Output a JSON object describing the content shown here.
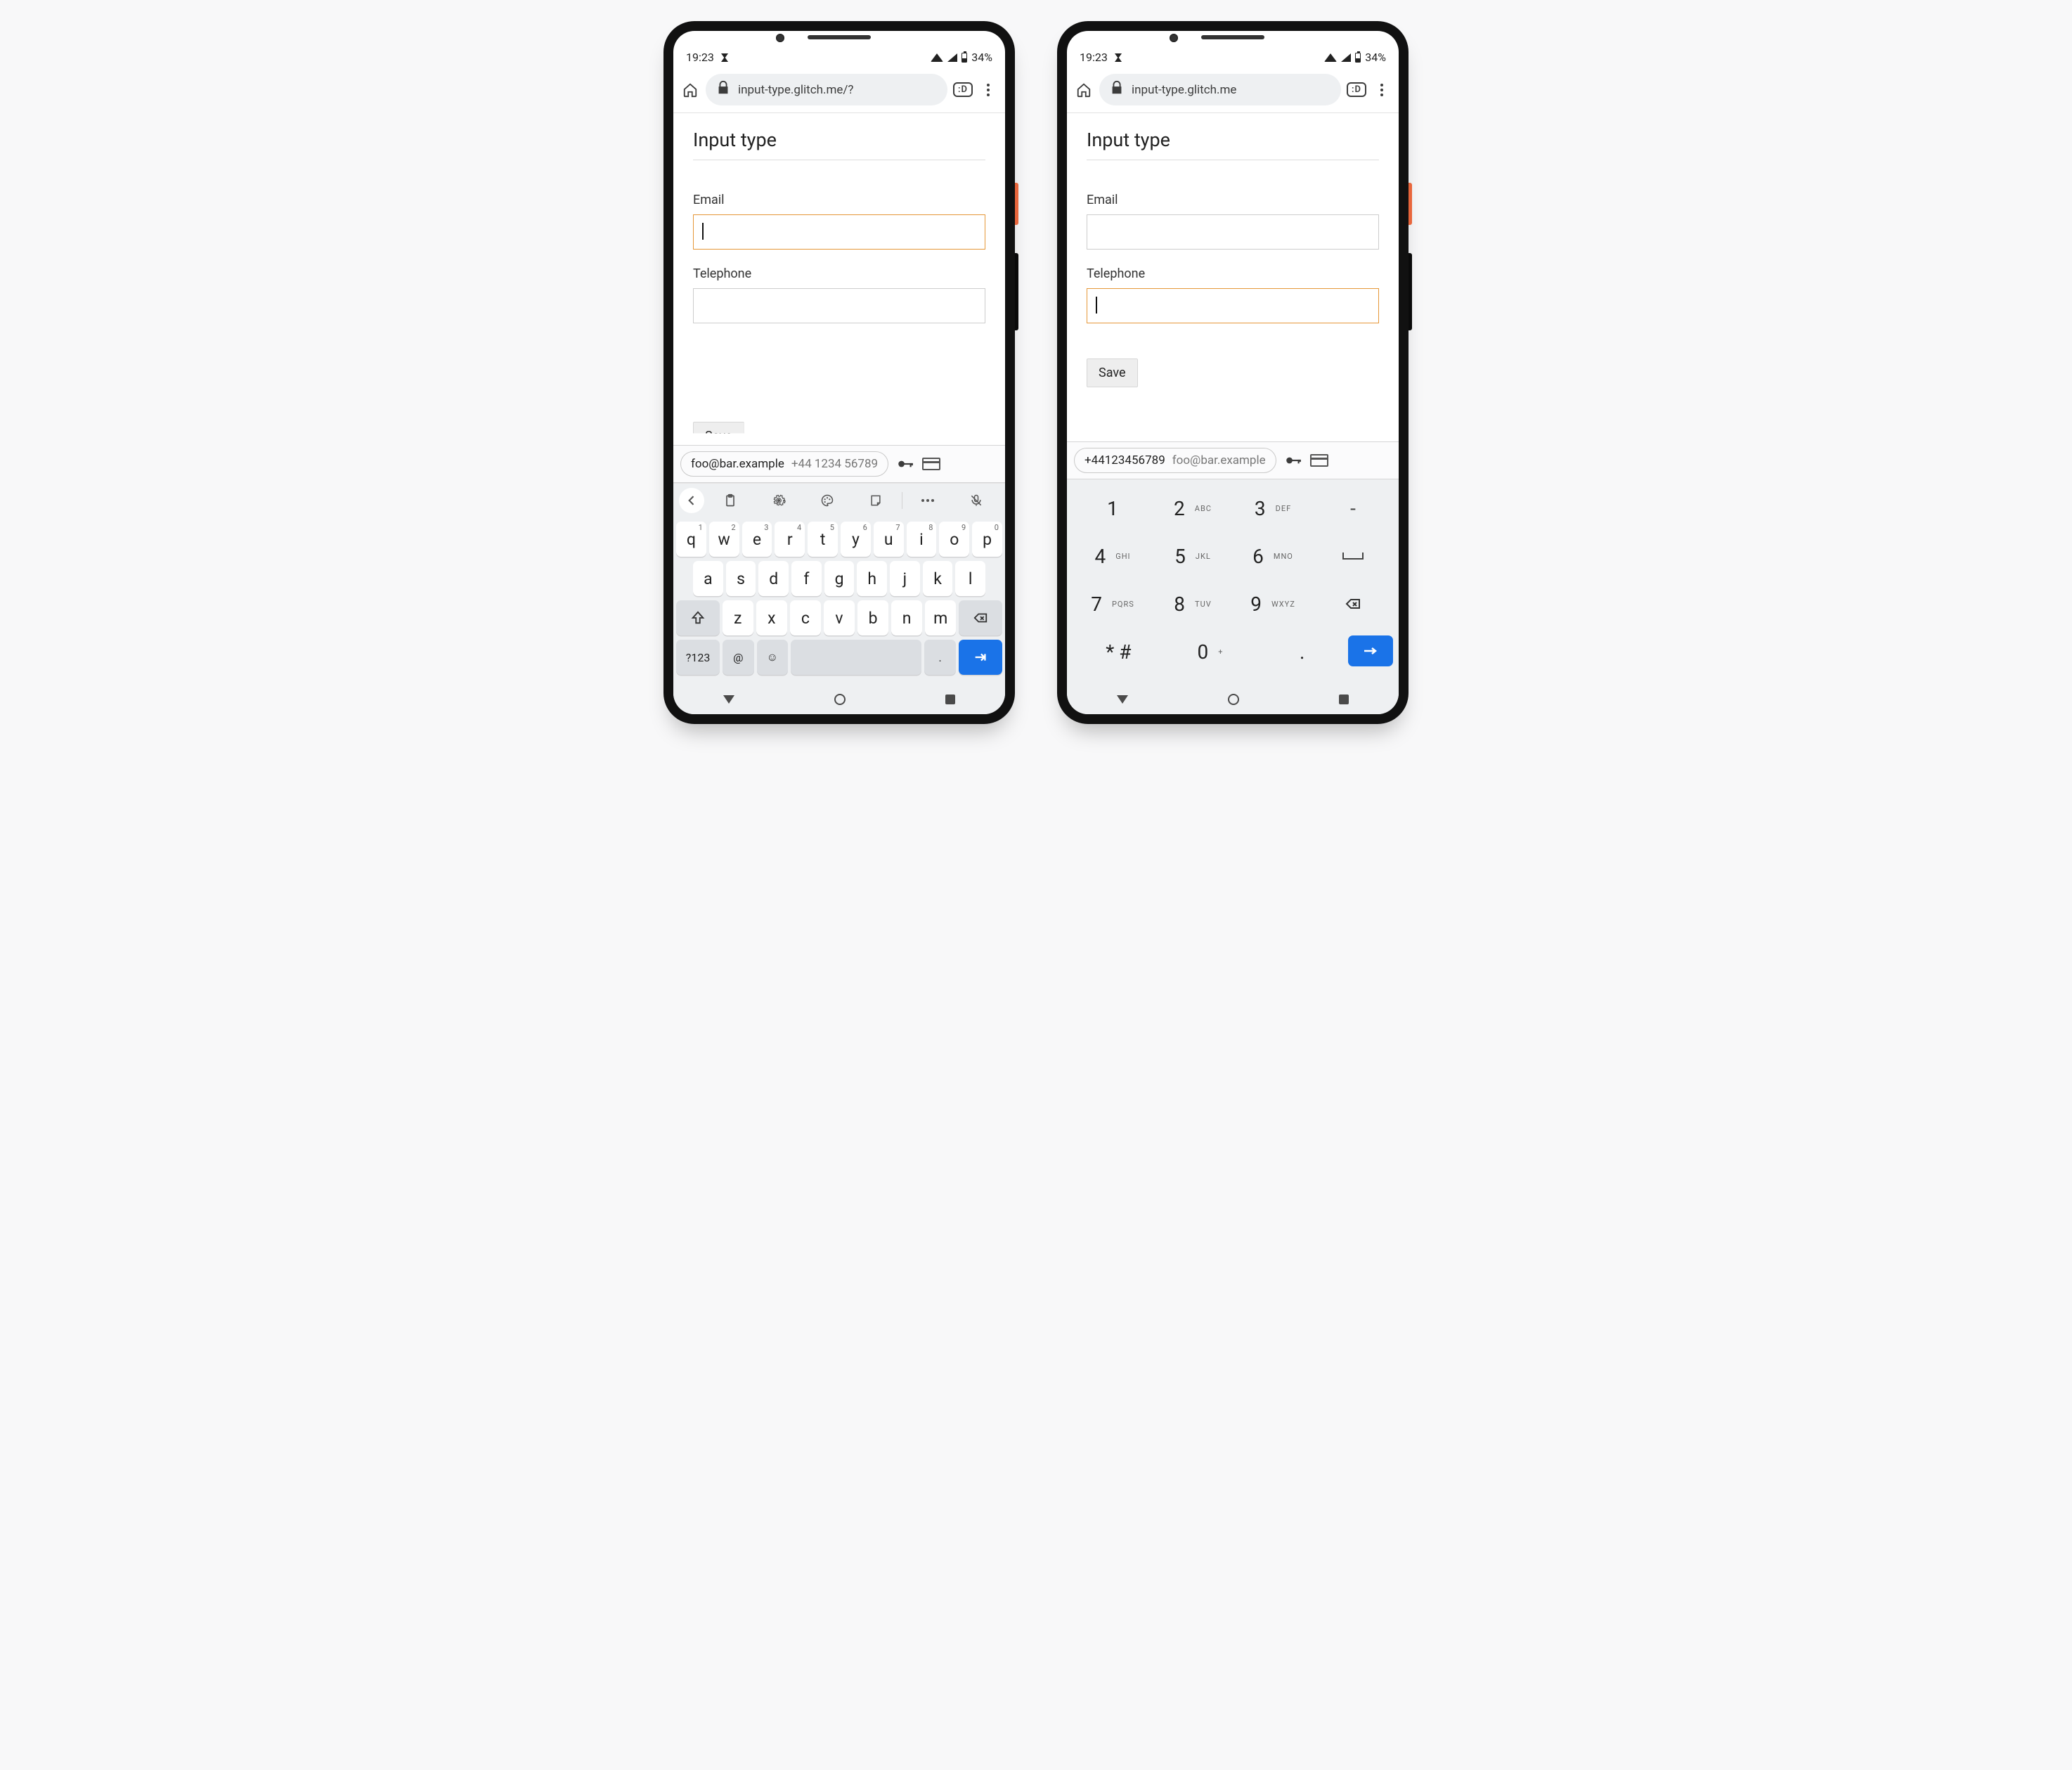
{
  "status": {
    "time": "19:23",
    "battery": "34%"
  },
  "browser": {
    "url_left": "input-type.glitch.me/?",
    "url_right": "input-type.glitch.me",
    "tab_badge": ":D"
  },
  "page": {
    "title": "Input type",
    "email_label": "Email",
    "tel_label": "Telephone",
    "save_label": "Save"
  },
  "autofill": {
    "email": "foo@bar.example",
    "phone_spaced": "+44 1234 56789",
    "phone_joined": "+44123456789"
  },
  "qwerty": {
    "row1": [
      {
        "k": "q",
        "s": "1"
      },
      {
        "k": "w",
        "s": "2"
      },
      {
        "k": "e",
        "s": "3"
      },
      {
        "k": "r",
        "s": "4"
      },
      {
        "k": "t",
        "s": "5"
      },
      {
        "k": "y",
        "s": "6"
      },
      {
        "k": "u",
        "s": "7"
      },
      {
        "k": "i",
        "s": "8"
      },
      {
        "k": "o",
        "s": "9"
      },
      {
        "k": "p",
        "s": "0"
      }
    ],
    "row2": [
      "a",
      "s",
      "d",
      "f",
      "g",
      "h",
      "j",
      "k",
      "l"
    ],
    "row3": [
      "z",
      "x",
      "c",
      "v",
      "b",
      "n",
      "m"
    ],
    "sym": "?123",
    "at": "@",
    "period": "."
  },
  "numpad": {
    "keys": [
      [
        {
          "n": "1",
          "t": ""
        },
        {
          "n": "2",
          "t": "ABC"
        },
        {
          "n": "3",
          "t": "DEF"
        }
      ],
      [
        {
          "n": "4",
          "t": "GHI"
        },
        {
          "n": "5",
          "t": "JKL"
        },
        {
          "n": "6",
          "t": "MNO"
        }
      ],
      [
        {
          "n": "7",
          "t": "PQRS"
        },
        {
          "n": "8",
          "t": "TUV"
        },
        {
          "n": "9",
          "t": "WXYZ"
        }
      ],
      [
        {
          "n": "* #",
          "t": ""
        },
        {
          "n": "0",
          "t": "+"
        },
        {
          "n": ".",
          "t": ""
        }
      ]
    ],
    "dash": "-"
  }
}
